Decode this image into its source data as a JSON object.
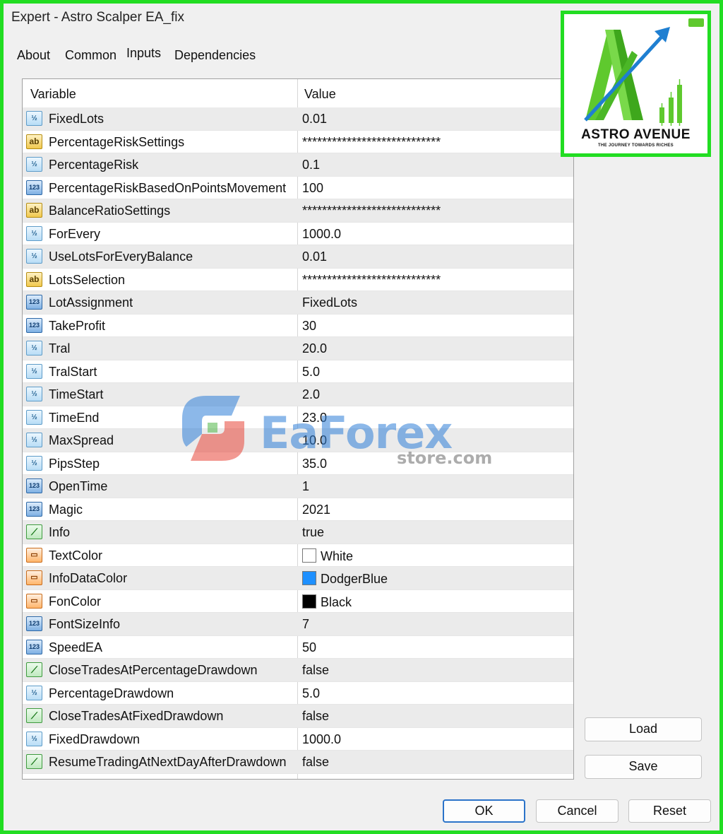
{
  "window": {
    "title": "Expert - Astro Scalper EA_fix"
  },
  "tabs": [
    {
      "label": "About",
      "active": false
    },
    {
      "label": "Common",
      "active": false
    },
    {
      "label": "Inputs",
      "active": true
    },
    {
      "label": "Dependencies",
      "active": false
    }
  ],
  "table": {
    "headers": {
      "variable": "Variable",
      "value": "Value"
    },
    "rows": [
      {
        "type": "half",
        "icon": "½",
        "name": "FixedLots",
        "value": "0.01"
      },
      {
        "type": "ab",
        "icon": "ab",
        "name": "PercentageRiskSettings",
        "value": "****************************"
      },
      {
        "type": "half",
        "icon": "½",
        "name": "PercentageRisk",
        "value": "0.1"
      },
      {
        "type": "123",
        "icon": "123",
        "name": "PercentageRiskBasedOnPointsMovement",
        "value": "100"
      },
      {
        "type": "ab",
        "icon": "ab",
        "name": "BalanceRatioSettings",
        "value": "****************************"
      },
      {
        "type": "half",
        "icon": "½",
        "name": "ForEvery",
        "value": "1000.0"
      },
      {
        "type": "half",
        "icon": "½",
        "name": "UseLotsForEveryBalance",
        "value": "0.01"
      },
      {
        "type": "ab",
        "icon": "ab",
        "name": "LotsSelection",
        "value": "****************************"
      },
      {
        "type": "123",
        "icon": "123",
        "name": "LotAssignment",
        "value": "FixedLots"
      },
      {
        "type": "123",
        "icon": "123",
        "name": "TakeProfit",
        "value": "30"
      },
      {
        "type": "half",
        "icon": "½",
        "name": "Tral",
        "value": "20.0"
      },
      {
        "type": "half",
        "icon": "½",
        "name": "TralStart",
        "value": "5.0"
      },
      {
        "type": "half",
        "icon": "½",
        "name": "TimeStart",
        "value": "2.0"
      },
      {
        "type": "half",
        "icon": "½",
        "name": "TimeEnd",
        "value": "23.0"
      },
      {
        "type": "half",
        "icon": "½",
        "name": "MaxSpread",
        "value": "10.0"
      },
      {
        "type": "half",
        "icon": "½",
        "name": "PipsStep",
        "value": "35.0"
      },
      {
        "type": "123",
        "icon": "123",
        "name": "OpenTime",
        "value": "1"
      },
      {
        "type": "123",
        "icon": "123",
        "name": "Magic",
        "value": "2021"
      },
      {
        "type": "bool",
        "icon": "⟋",
        "name": "Info",
        "value": "true"
      },
      {
        "type": "color",
        "icon": "▭",
        "name": "TextColor",
        "value": "White",
        "swatch": "#ffffff"
      },
      {
        "type": "color",
        "icon": "▭",
        "name": "InfoDataColor",
        "value": "DodgerBlue",
        "swatch": "#1e90ff"
      },
      {
        "type": "color",
        "icon": "▭",
        "name": "FonColor",
        "value": "Black",
        "swatch": "#000000"
      },
      {
        "type": "123",
        "icon": "123",
        "name": "FontSizeInfo",
        "value": "7"
      },
      {
        "type": "123",
        "icon": "123",
        "name": "SpeedEA",
        "value": "50"
      },
      {
        "type": "bool",
        "icon": "⟋",
        "name": "CloseTradesAtPercentageDrawdown",
        "value": "false"
      },
      {
        "type": "half",
        "icon": "½",
        "name": "PercentageDrawdown",
        "value": "5.0"
      },
      {
        "type": "bool",
        "icon": "⟋",
        "name": "CloseTradesAtFixedDrawdown",
        "value": "false"
      },
      {
        "type": "half",
        "icon": "½",
        "name": "FixedDrawdown",
        "value": "1000.0"
      },
      {
        "type": "bool",
        "icon": "⟋",
        "name": "ResumeTradingAtNextDayAfterDrawdown",
        "value": "false"
      }
    ]
  },
  "side_buttons": {
    "load": "Load",
    "save": "Save"
  },
  "footer_buttons": {
    "ok": "OK",
    "cancel": "Cancel",
    "reset": "Reset"
  },
  "logo": {
    "brand": "ASTRO AVENUE",
    "tagline": "THE JOURNEY TOWARDS RICHES"
  },
  "watermark": {
    "main": "EaForex",
    "sub": "store.com"
  },
  "colors": {
    "frame": "#22dd22",
    "accent_blue": "#2b73c9",
    "logo_green": "#5fc92e",
    "logo_arrow": "#1f7fd1"
  }
}
